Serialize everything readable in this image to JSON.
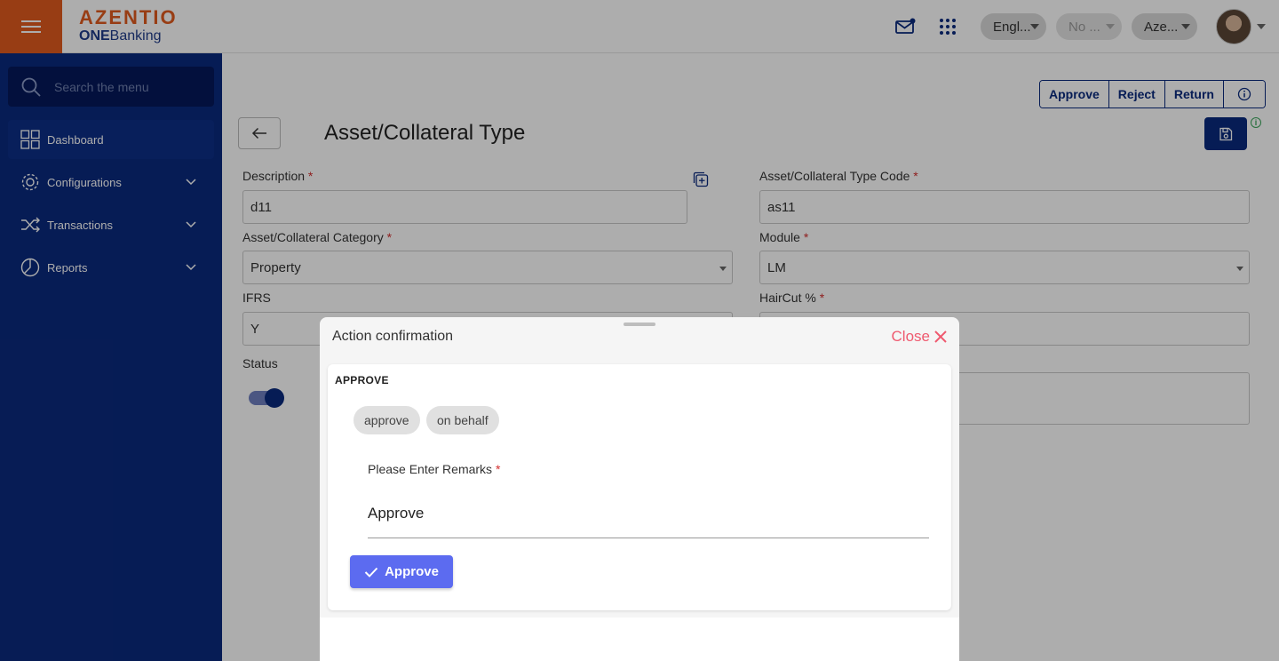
{
  "brand": {
    "name": "AZENTIO",
    "sub_bold": "ONE",
    "sub_rest": "Banking"
  },
  "topbar": {
    "language": "Engl...",
    "second_select": "No ...",
    "third_select": "Aze..."
  },
  "sidebar": {
    "search_placeholder": "Search the menu",
    "items": [
      {
        "label": "Dashboard",
        "icon": "grid-icon"
      },
      {
        "label": "Configurations",
        "icon": "gear-icon"
      },
      {
        "label": "Transactions",
        "icon": "shuffle-icon"
      },
      {
        "label": "Reports",
        "icon": "pie-chart-icon"
      }
    ]
  },
  "actions": {
    "approve": "Approve",
    "reject": "Reject",
    "return": "Return"
  },
  "page": {
    "title": "Asset/Collateral Type"
  },
  "form": {
    "description_label": "Description",
    "description_value": "d11",
    "type_code_label": "Asset/Collateral Type Code",
    "type_code_value": "as11",
    "category_label": "Asset/Collateral Category",
    "category_value": "Property",
    "module_label": "Module",
    "module_value": "LM",
    "ifrs_label": "IFRS",
    "ifrs_value": "Y",
    "haircut_label": "HairCut %",
    "haircut_value": "",
    "status_label": "Status",
    "required_mark": "*"
  },
  "modal": {
    "title": "Action confirmation",
    "close_label": "Close",
    "heading": "APPROVE",
    "chips": [
      "approve",
      "on behalf"
    ],
    "remarks_label": "Please Enter Remarks",
    "remarks_value": "Approve",
    "submit_label": "Approve"
  },
  "colors": {
    "accent": "#e05a1e",
    "sidebar": "#0a2a7e",
    "primary_button": "#5c6bf0",
    "close": "#ef5a6f"
  }
}
